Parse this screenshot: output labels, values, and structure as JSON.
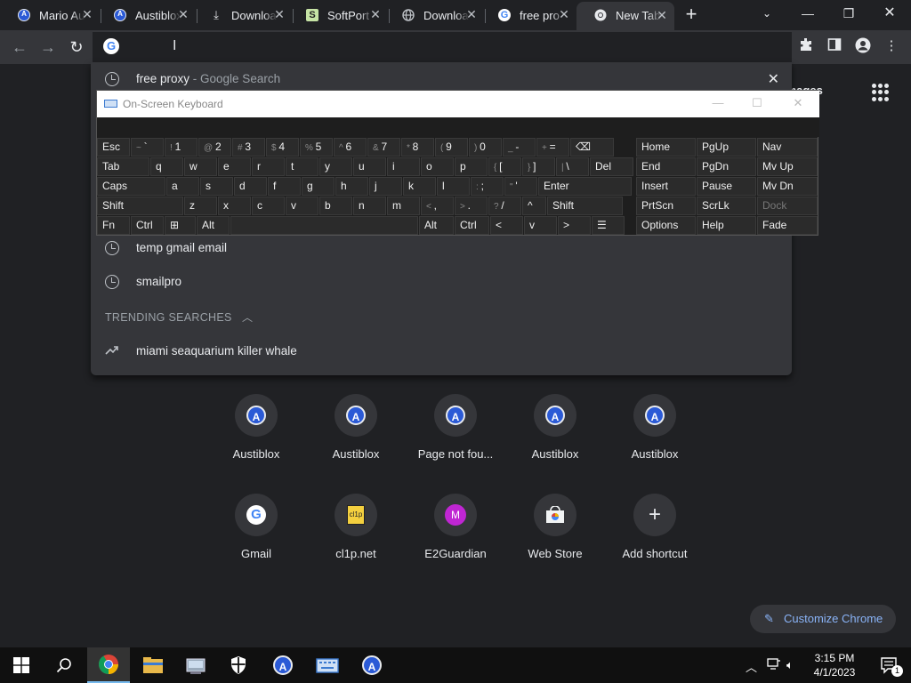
{
  "browser": {
    "tabs": [
      {
        "title": "Mario Au",
        "icon": "austiblox-icon"
      },
      {
        "title": "Austiblox",
        "icon": "austiblox-icon"
      },
      {
        "title": "Downloa",
        "icon": "download-icon"
      },
      {
        "title": "SoftPort",
        "icon": "softportal-icon"
      },
      {
        "title": "Downloa",
        "icon": "globe-icon"
      },
      {
        "title": "free pro",
        "icon": "google-icon"
      },
      {
        "title": "New Tab",
        "icon": "chrome-icon"
      }
    ],
    "new_tab_label": "+",
    "window_controls": {
      "minimize": "—",
      "restore": "❐",
      "close": "✕"
    }
  },
  "omnibox": {
    "value": ""
  },
  "ntp": {
    "top_links": "Images"
  },
  "suggestions": {
    "top": {
      "text": "free proxy",
      "sub": " - Google Search",
      "remove": "✕"
    },
    "items": [
      {
        "text": "temp gmail email"
      },
      {
        "text": "smailpro"
      }
    ],
    "trending_header": "TRENDING SEARCHES",
    "trending": [
      {
        "text": "miami seaquarium killer whale"
      }
    ]
  },
  "osk": {
    "title": "On-Screen Keyboard",
    "rows": [
      [
        {
          "l": "Esc"
        },
        {
          "s": "~",
          "l": "`"
        },
        {
          "s": "!",
          "l": "1"
        },
        {
          "s": "@",
          "l": "2"
        },
        {
          "s": "#",
          "l": "3"
        },
        {
          "s": "$",
          "l": "4"
        },
        {
          "s": "%",
          "l": "5"
        },
        {
          "s": "^",
          "l": "6"
        },
        {
          "s": "&",
          "l": "7"
        },
        {
          "s": "*",
          "l": "8"
        },
        {
          "s": "(",
          "l": "9"
        },
        {
          "s": ")",
          "l": "0"
        },
        {
          "s": "_",
          "l": "-"
        },
        {
          "s": "+",
          "l": "="
        },
        {
          "l": "⌫"
        }
      ],
      [
        {
          "l": "Tab"
        },
        {
          "l": "q"
        },
        {
          "l": "w"
        },
        {
          "l": "e"
        },
        {
          "l": "r"
        },
        {
          "l": "t"
        },
        {
          "l": "y"
        },
        {
          "l": "u"
        },
        {
          "l": "i"
        },
        {
          "l": "o"
        },
        {
          "l": "p"
        },
        {
          "s": "{",
          "l": "["
        },
        {
          "s": "}",
          "l": "]"
        },
        {
          "s": "|",
          "l": "\\"
        },
        {
          "l": "Del"
        }
      ],
      [
        {
          "l": "Caps"
        },
        {
          "l": "a"
        },
        {
          "l": "s"
        },
        {
          "l": "d"
        },
        {
          "l": "f"
        },
        {
          "l": "g"
        },
        {
          "l": "h"
        },
        {
          "l": "j"
        },
        {
          "l": "k"
        },
        {
          "l": "l"
        },
        {
          "s": ":",
          "l": ";"
        },
        {
          "s": "\"",
          "l": "'"
        },
        {
          "l": "Enter"
        }
      ],
      [
        {
          "l": "Shift"
        },
        {
          "l": "z"
        },
        {
          "l": "x"
        },
        {
          "l": "c"
        },
        {
          "l": "v"
        },
        {
          "l": "b"
        },
        {
          "l": "n"
        },
        {
          "l": "m"
        },
        {
          "s": "<",
          "l": ","
        },
        {
          "s": ">",
          "l": "."
        },
        {
          "s": "?",
          "l": "/"
        },
        {
          "l": "^"
        },
        {
          "l": "Shift"
        }
      ],
      [
        {
          "l": "Fn"
        },
        {
          "l": "Ctrl"
        },
        {
          "l": "⊞"
        },
        {
          "l": "Alt"
        },
        {
          "l": ""
        },
        {
          "l": "Alt"
        },
        {
          "l": "Ctrl"
        },
        {
          "l": "<"
        },
        {
          "l": "v"
        },
        {
          "l": ">"
        },
        {
          "l": "☰"
        }
      ]
    ],
    "side": [
      [
        "Home",
        "PgUp",
        "Nav"
      ],
      [
        "End",
        "PgDn",
        "Mv Up"
      ],
      [
        "Insert",
        "Pause",
        "Mv Dn"
      ],
      [
        "PrtScn",
        "ScrLk",
        "Dock"
      ],
      [
        "Options",
        "Help",
        "Fade"
      ]
    ]
  },
  "shortcuts": [
    {
      "label": "Austiblox",
      "icon": "austiblox-icon"
    },
    {
      "label": "Austiblox",
      "icon": "austiblox-icon"
    },
    {
      "label": "Page not fou...",
      "icon": "austiblox-icon"
    },
    {
      "label": "Austiblox",
      "icon": "austiblox-icon"
    },
    {
      "label": "Austiblox",
      "icon": "austiblox-icon"
    },
    {
      "label": "Gmail",
      "icon": "google-icon"
    },
    {
      "label": "cl1p.net",
      "icon": "clipboard-icon"
    },
    {
      "label": "E2Guardian",
      "icon": "letter-m-icon",
      "badge": "M"
    },
    {
      "label": "Web Store",
      "icon": "webstore-icon"
    },
    {
      "label": "Add shortcut",
      "icon": "plus-icon"
    }
  ],
  "customize": {
    "label": "Customize Chrome"
  },
  "taskbar": {
    "time": "3:15 PM",
    "date": "4/1/2023",
    "notification_count": "1"
  },
  "colors": {
    "accent": "#8ab4f8",
    "background": "#202124",
    "surface": "#35363a"
  }
}
